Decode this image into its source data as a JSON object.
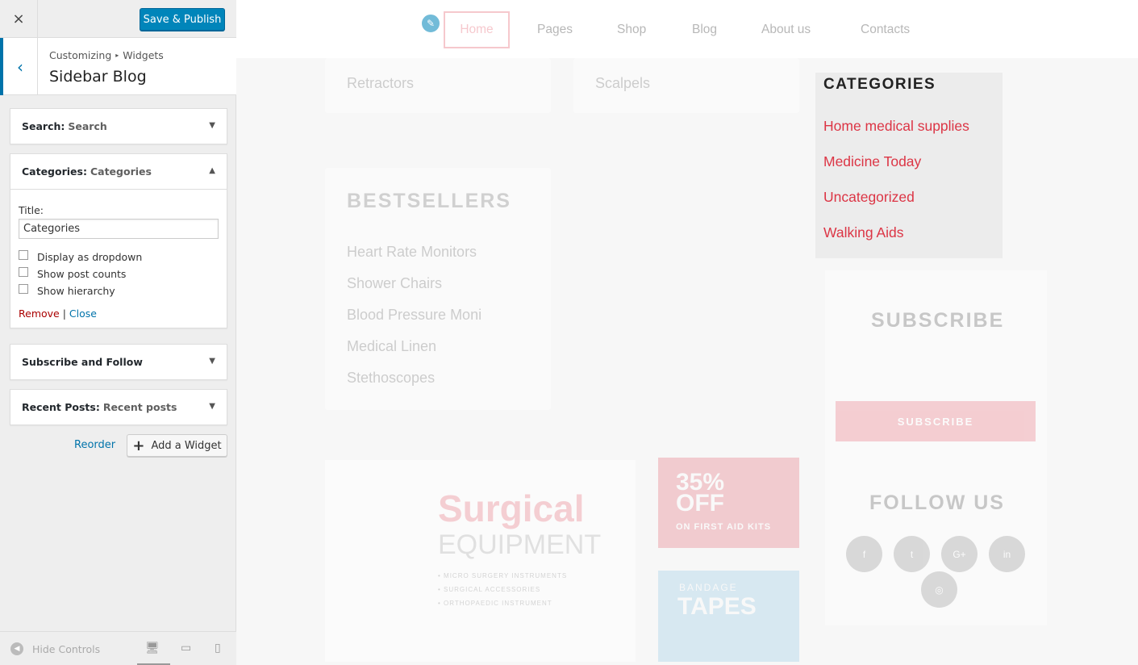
{
  "customizer": {
    "close_icon": "×",
    "publish_label": "Save & Publish",
    "back_icon": "‹",
    "breadcrumb_root": "Customizing",
    "breadcrumb_sep": "▸",
    "breadcrumb_leaf": "Widgets",
    "section_title": "Sidebar Blog",
    "widgets": [
      {
        "name": "Search:",
        "sub": "Search",
        "toggle": "▼"
      },
      {
        "name": "Categories:",
        "sub": "Categories",
        "toggle": "▲"
      },
      {
        "name": "Subscribe and Follow",
        "sub": "",
        "toggle": "▼"
      },
      {
        "name": "Recent Posts:",
        "sub": "Recent posts",
        "toggle": "▼"
      }
    ],
    "categories_form": {
      "title_label": "Title:",
      "title_value": "Categories",
      "options": [
        {
          "label": "Display as dropdown",
          "checked": false
        },
        {
          "label": "Show post counts",
          "checked": false
        },
        {
          "label": "Show hierarchy",
          "checked": false
        }
      ],
      "remove_label": "Remove",
      "divider": "|",
      "close_label": "Close"
    },
    "reorder_label": "Reorder",
    "add_widget_label": "Add a Widget",
    "add_widget_icon": "+",
    "hide_controls_label": "Hide Controls",
    "hide_controls_icon": "◀",
    "devices": {
      "desktop": "🖥",
      "tablet": "▭",
      "mobile": "▯"
    }
  },
  "preview": {
    "nav": [
      "Home",
      "Pages",
      "Shop",
      "Blog",
      "About us",
      "Contacts"
    ],
    "edit_icon": "✎",
    "top_products": [
      "Retractors",
      "Scalpels"
    ],
    "bestsellers_title": "BESTSELLERS",
    "bestsellers": [
      "Heart Rate Monitors",
      "Shower Chairs",
      "Blood Pressure Moni",
      "Medical Linen",
      "Stethoscopes"
    ],
    "categories_title": "CATEGORIES",
    "categories": [
      "Home medical supplies",
      "Medicine Today",
      "Uncategorized",
      "Walking Aids"
    ],
    "subscribe_title": "SUBSCRIBE",
    "subscribe_button": "SUBSCRIBE",
    "follow_title": "FOLLOW US",
    "social": [
      "f",
      "t",
      "G+",
      "in",
      "◎"
    ],
    "banner_title": "Surgical",
    "banner_subtitle": "EQUIPMENT",
    "banner_bullets": [
      "• MICRO SURGERY INSTRUMENTS",
      "• SURGICAL ACCESSORIES",
      "• ORTHOPAEDIC INSTRUMENT"
    ],
    "promo1_line1": "35%",
    "promo1_line2": "OFF",
    "promo1_line3": "ON FIRST AID KITS",
    "promo2_line1": "BANDAGE",
    "promo2_line2": "TAPES"
  },
  "colors": {
    "accent": "#0085ba",
    "brand": "#e34b5c",
    "link": "#0073aa"
  }
}
